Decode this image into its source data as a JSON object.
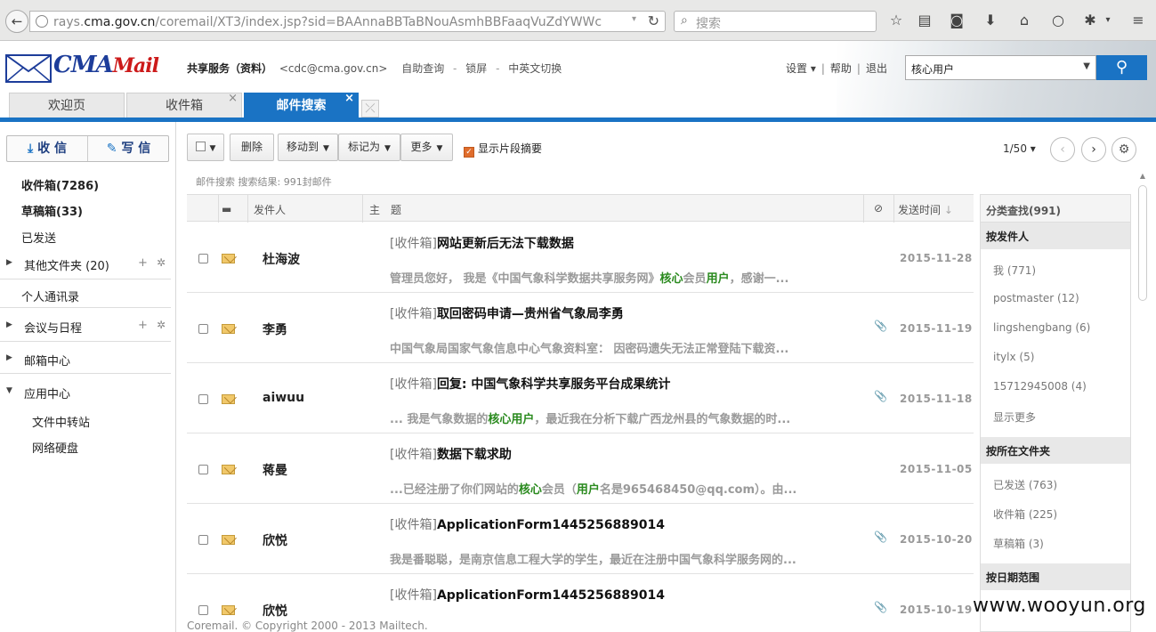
{
  "browser": {
    "url_prefix": "rays.",
    "url_domain": "cma.gov.cn",
    "url_path": "/coremail/XT3/index.jsp?sid=BAAnnaBBTaBNouAsmhBBFaaqVuZdYWWc",
    "search_placeholder": "搜索"
  },
  "header": {
    "logo_main": "CMA",
    "logo_sub": "Mail",
    "user_name": "共享服务（资料）",
    "user_email": "<cdc@cma.gov.cn>",
    "links": [
      "自助查询",
      "锁屏",
      "中英文切换"
    ],
    "settings": "设置",
    "help": "帮助",
    "logout": "退出",
    "search_scope": "核心用户"
  },
  "tabs": [
    {
      "label": "欢迎页"
    },
    {
      "label": "收件箱"
    },
    {
      "label": "邮件搜索"
    }
  ],
  "sidebar": {
    "receive": "收 信",
    "compose": "写 信",
    "inbox": "收件箱(7286)",
    "drafts": "草稿箱(33)",
    "sent": "已发送",
    "other_folders": "其他文件夹 (20)",
    "contacts": "个人通讯录",
    "calendar": "会议与日程",
    "mail_center": "邮箱中心",
    "app_center": "应用中心",
    "file_transfer": "文件中转站",
    "netdisk": "网络硬盘"
  },
  "toolbar": {
    "delete": "删除",
    "move": "移动到",
    "mark": "标记为",
    "more": "更多",
    "show_snippet": "显示片段摘要",
    "page": "1/50"
  },
  "result_info": "邮件搜索 搜索结果: 991封邮件",
  "table": {
    "col_sender": "发件人",
    "col_subject": "主　题",
    "col_date": "发送时间"
  },
  "mails": [
    {
      "sender": "杜海波",
      "folder": "[收件箱]",
      "subject": "网站更新后无法下载数据",
      "snip_a": "管理员您好， 我是《中国气象科学数据共享服务网》",
      "snip_h1": "核心",
      "snip_b": "会员",
      "snip_h2": "用户",
      "snip_c": "，感谢一...",
      "date": "2015-11-28",
      "attach": ""
    },
    {
      "sender": "李勇",
      "folder": "[收件箱]",
      "subject": "取回密码申请—贵州省气象局李勇",
      "snip_a": "中国气象局国家气象信息中心气象资料室： 因密码遗失无法正常登陆下载资...",
      "snip_h1": "",
      "snip_b": "",
      "snip_h2": "",
      "snip_c": "",
      "date": "2015-11-19",
      "attach": "📎"
    },
    {
      "sender": "aiwuu",
      "folder": "[收件箱]",
      "subject": "回复: 中国气象科学共享服务平台成果统计",
      "snip_a": "... 我是气象数据的",
      "snip_h1": "核心",
      "snip_b": "",
      "snip_h2": "用户",
      "snip_c": "，最近我在分析下载广西龙州县的气象数据的时...",
      "date": "2015-11-18",
      "attach": "📎"
    },
    {
      "sender": "蒋曼",
      "folder": "[收件箱]",
      "subject": "数据下载求助",
      "snip_a": "...已经注册了你们网站的",
      "snip_h1": "核心",
      "snip_b": "会员（",
      "snip_h2": "用户",
      "snip_c": "名是965468450@qq.com）。由...",
      "date": "2015-11-05",
      "attach": ""
    },
    {
      "sender": "欣悦",
      "folder": "[收件箱]",
      "subject": "ApplicationForm1445256889014",
      "snip_a": "我是番聪聪，是南京信息工程大学的学生，最近在注册中国气象科学服务网的...",
      "snip_h1": "",
      "snip_b": "",
      "snip_h2": "",
      "snip_c": "",
      "date": "2015-10-20",
      "attach": "📎"
    },
    {
      "sender": "欣悦",
      "folder": "[收件箱]",
      "subject": "ApplicationForm1445256889014",
      "snip_a": "",
      "snip_h1": "",
      "snip_b": "",
      "snip_h2": "",
      "snip_c": "",
      "date": "2015-10-19",
      "attach": "📎"
    }
  ],
  "categories": {
    "title": "分类查找(991)",
    "by_sender": "按发件人",
    "senders": [
      "我 (771)",
      "postmaster (12)",
      "lingshengbang (6)",
      "itylx (5)",
      "15712945008 (4)",
      "显示更多"
    ],
    "by_folder": "按所在文件夹",
    "folders": [
      "已发送 (763)",
      "收件箱 (225)",
      "草稿箱 (3)"
    ],
    "by_date": "按日期范围"
  },
  "footer": "Coremail. © Copyright 2000 - 2013 Mailtech.",
  "watermark": "www.wooyun.org"
}
